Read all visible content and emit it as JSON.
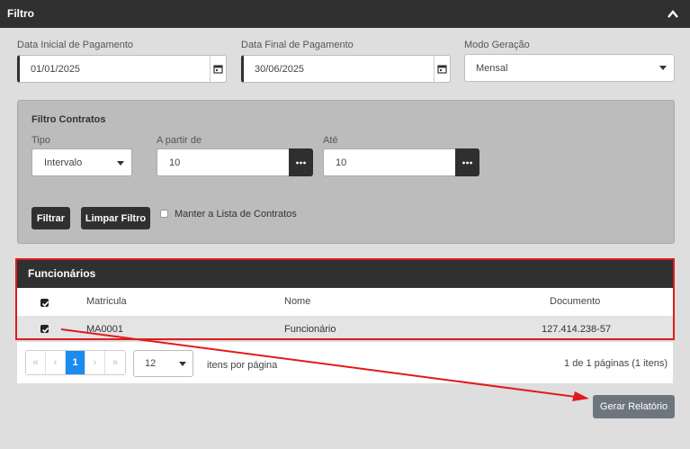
{
  "header": {
    "title": "Filtro",
    "collapse_icon": "chevron-up-icon"
  },
  "fields": {
    "start_date": {
      "label": "Data Inicial de Pagamento",
      "value": "01/01/2025",
      "icon": "calendar-icon"
    },
    "end_date": {
      "label": "Data Final de Pagamento",
      "value": "30/06/2025",
      "icon": "calendar-icon"
    },
    "mode": {
      "label": "Modo Geração",
      "value": "Mensal"
    }
  },
  "contracts_filter": {
    "title": "Filtro Contratos",
    "type": {
      "label": "Tipo",
      "value": "Intervalo"
    },
    "from": {
      "label": "A partir de",
      "value": "10"
    },
    "to": {
      "label": "Até",
      "value": "10"
    },
    "filter_label": "Filtrar",
    "clear_label": "Limpar Filtro",
    "keep_list_label": "Manter a Lista de Contratos",
    "keep_list_checked": false
  },
  "employees": {
    "title": "Funcionários",
    "columns": [
      "Matricula",
      "Nome",
      "Documento"
    ],
    "rows": [
      {
        "checked": true,
        "matricula": "MA0001",
        "nome": "Funcionário",
        "documento": "127.414.238-57"
      }
    ],
    "select_all_checked": true
  },
  "pager": {
    "first": "«",
    "prev": "‹",
    "current": "1",
    "next": "›",
    "last": "»",
    "page_size": "12",
    "per_page_label": "itens por página",
    "info": "1 de 1 páginas (1 itens)"
  },
  "generate_label": "Gerar Relatório",
  "colors": {
    "dark": "#303030",
    "accent_blue": "#1a8cf0",
    "annotation_red": "#e01b1b",
    "button_gray": "#6d767e"
  }
}
